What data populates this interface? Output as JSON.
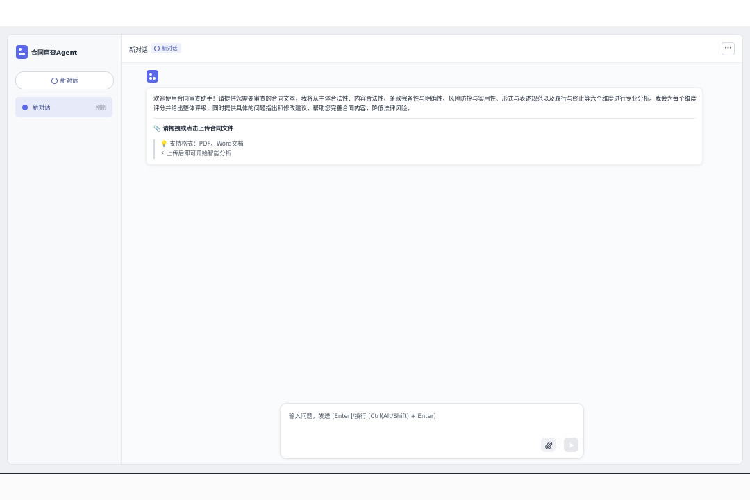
{
  "app": {
    "name": "合同审查Agent"
  },
  "sidebar": {
    "new_chat_label": "新对话",
    "conversations": [
      {
        "title": "新对话",
        "time": "刚刚"
      }
    ]
  },
  "header": {
    "title": "新对话",
    "tag": "新对话",
    "more_label": "···"
  },
  "message": {
    "text": "欢迎使用合同审查助手！请提供您需要审查的合同文本，我将从主体合法性、内容合法性、条款完备性与明确性、风险防控与实用性、形式与表述规范以及履行与终止等六个维度进行专业分析。我会为每个维度评分并给出整体评级，同时提供具体的问题指出和修改建议，帮助您完善合同内容，降低法律风险。",
    "upload_title": "📎 请拖拽或点击上传合同文件",
    "tips": [
      "💡 支持格式：PDF、Word文档",
      "⚡ 上传后即可开始智能分析"
    ]
  },
  "composer": {
    "placeholder": "输入问题，发送 [Enter]/换行 [Ctrl(Alt/Shift) + Enter]",
    "value": ""
  },
  "colors": {
    "accent": "#5b67e6",
    "active_item_bg": "#e7eaf9",
    "stage_bg": "#eff0f4"
  },
  "icons": [
    "logo-icon",
    "chat-bubble-icon",
    "clock-icon",
    "more-icon",
    "bot-avatar-icon",
    "paperclip-icon",
    "send-icon"
  ]
}
